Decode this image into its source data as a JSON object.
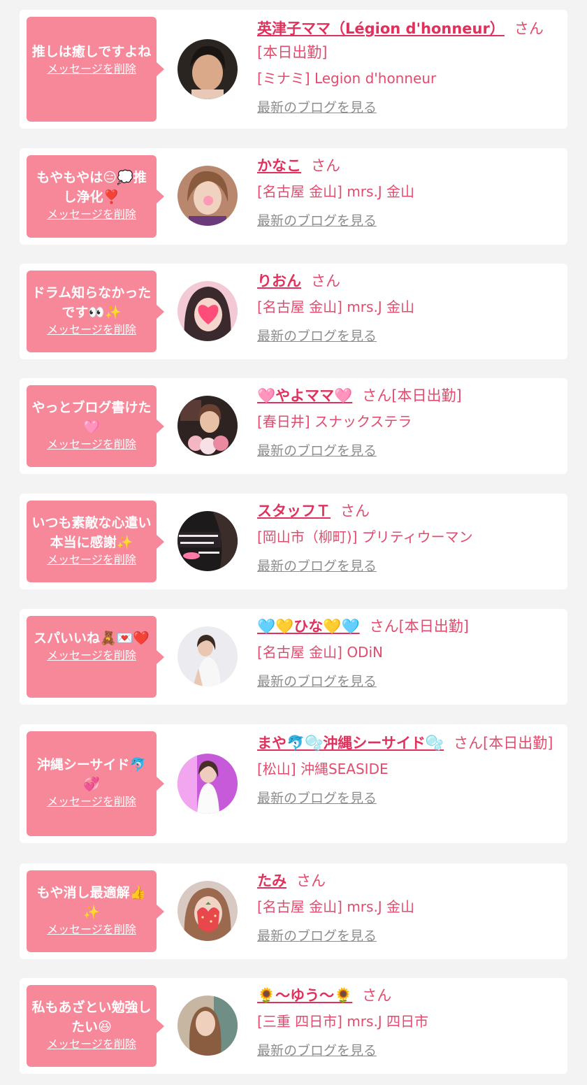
{
  "colors": {
    "bubble": "#f7889a",
    "name": "#e0315c",
    "text": "#e24b6d",
    "muted": "#8d8d8d",
    "background": "#f3f3f3"
  },
  "delete_label": "メッセージを削除",
  "blog_label": "最新のブログを見る",
  "cards": [
    {
      "message": "推しは癒しですよね",
      "name": "英津子ママ（Légion d'honneur）",
      "suffix": "さん[本日出勤]",
      "shop": "[ミナミ] Legion d'honneur"
    },
    {
      "message": "もやもやは😑💭推し浄化❣️",
      "name": "かなこ",
      "suffix": "さん",
      "shop": "[名古屋 金山] mrs.J 金山"
    },
    {
      "message": "ドラム知らなかったです👀✨",
      "name": "りおん",
      "suffix": "さん",
      "shop": "[名古屋 金山] mrs.J 金山"
    },
    {
      "message": "やっとブログ書けた🩷",
      "name": "🩷やよママ🩷",
      "suffix": "さん[本日出勤]",
      "shop": "[春日井] スナックステラ"
    },
    {
      "message": "いつも素敵な心遣い本当に感謝✨",
      "name": "スタッフＴ",
      "suffix": "さん",
      "shop": "[岡山市（柳町)] プリティウーマン"
    },
    {
      "message": "スパいいね🧸💌❤️",
      "name": "🩵💛ひな💛🩵",
      "suffix": "さん[本日出勤]",
      "shop": "[名古屋 金山] ODiN"
    },
    {
      "message": "沖縄シーサイド🐬💞",
      "name": "まや🐬🫧沖縄シーサイド🫧",
      "suffix": "さん[本日出勤]",
      "shop": "[松山] 沖縄SEASIDE"
    },
    {
      "message": "もや消し最適解👍✨",
      "name": "たみ",
      "suffix": "さん",
      "shop": "[名古屋 金山] mrs.J 金山"
    },
    {
      "message": "私もあざとい勉強したい😆",
      "name": "🌻～ゆう～🌻",
      "suffix": "さん",
      "shop": "[三重 四日市] mrs.J 四日市"
    }
  ]
}
